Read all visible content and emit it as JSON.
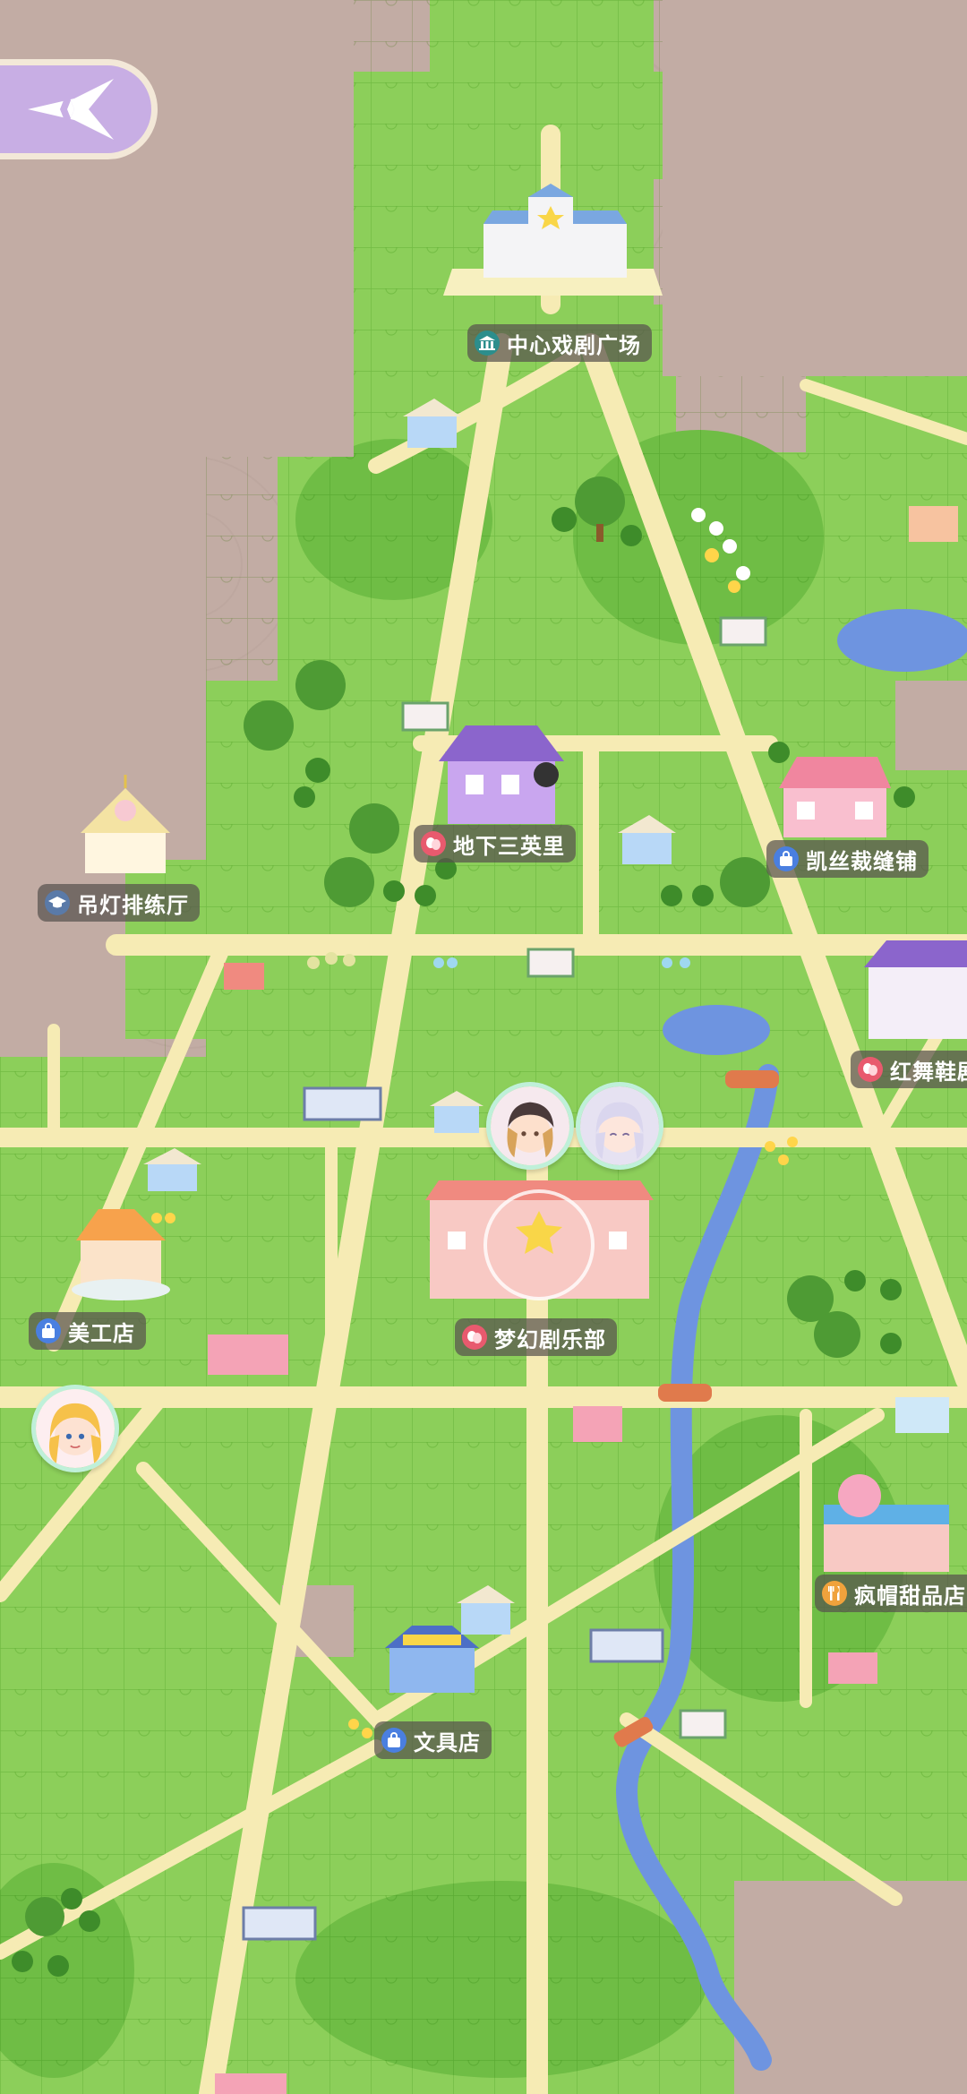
{
  "nav": {
    "back_icon": "compass-arrow-icon"
  },
  "locations": [
    {
      "name": "中心戏剧广场",
      "icon": "theater-building-icon"
    },
    {
      "name": "地下三英里",
      "icon": "drama-mask-icon"
    },
    {
      "name": "凯丝裁缝铺",
      "icon": "shop-bag-icon"
    },
    {
      "name": "吊灯排练厅",
      "icon": "graduation-cap-icon"
    },
    {
      "name": "红舞鞋剧",
      "icon": "drama-mask-icon"
    },
    {
      "name": "梦幻剧乐部",
      "icon": "drama-mask-icon"
    },
    {
      "name": "美工店",
      "icon": "shop-bag-icon"
    },
    {
      "name": "疯帽甜品店",
      "icon": "fork-knife-icon"
    },
    {
      "name": "文具店",
      "icon": "shop-bag-icon"
    }
  ],
  "avatars": [
    "character-avatar-dark-hair",
    "character-avatar-silver-hair",
    "character-avatar-blonde-hair"
  ],
  "colors": {
    "map_background": "#c2aca4",
    "grass": "#8ccf5a",
    "road": "#f6ebb4",
    "river": "#6e94e0",
    "label_bg": "#58524e",
    "back_button": "#c8aee4",
    "avatar_ring": "#bff0d9"
  }
}
